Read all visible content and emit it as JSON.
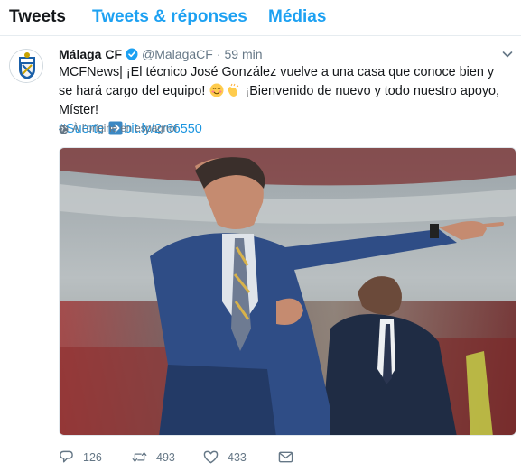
{
  "tabs": [
    {
      "label": "Tweets",
      "active": true
    },
    {
      "label": "Tweets & réponses",
      "active": false
    },
    {
      "label": "Médias",
      "active": false
    }
  ],
  "tweet": {
    "display_name": "Málaga CF",
    "handle": "@MalagaCF",
    "separator": "·",
    "time": "59 min",
    "text_part1": "MCFNews| ¡El técnico José González vuelve a una casa que conoce bien y se hará cargo del equipo! ",
    "text_part2": " ¡Bienvenido de nuevo y todo nuestro apoyo, Míster!",
    "hashtag": "#Suerte",
    "link": "bit.ly/2r66550",
    "translate_label": "À l'origine en espagnol",
    "reply_count": "126",
    "retweet_count": "493",
    "like_count": "433"
  },
  "colors": {
    "accent": "#1da1f2",
    "link": "#1b95e0",
    "muted": "#657786",
    "text": "#14171a"
  },
  "icons": {
    "verified": "verified-badge-icon",
    "caret": "chevron-down-icon",
    "globe": "globe-icon",
    "reply": "reply-icon",
    "retweet": "retweet-icon",
    "like": "heart-icon",
    "dm": "envelope-icon",
    "arrow": "right-arrow-emoji"
  }
}
